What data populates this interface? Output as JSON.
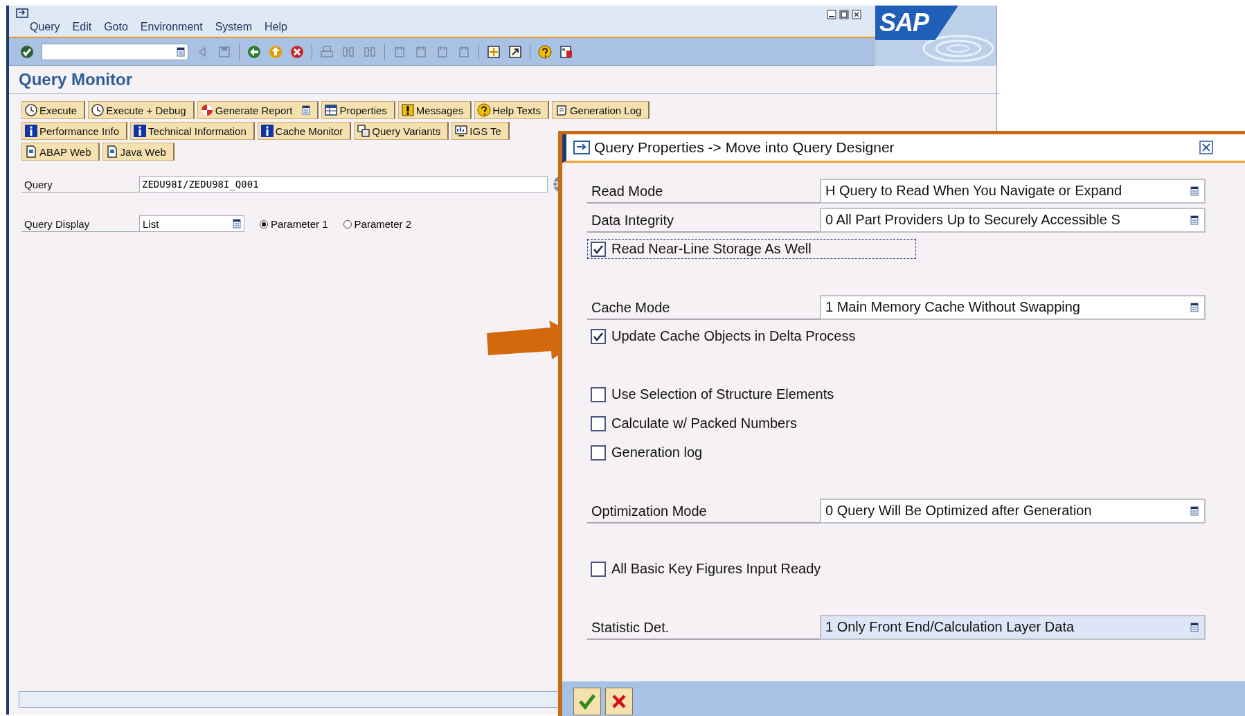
{
  "window": {
    "menu": [
      {
        "label": "Query"
      },
      {
        "label": "Edit"
      },
      {
        "label": "Goto"
      },
      {
        "label": "Environment"
      },
      {
        "label": "System"
      },
      {
        "label": "Help"
      }
    ],
    "logo": "SAP"
  },
  "title": "Query Monitor",
  "button_rows": [
    [
      {
        "label": "Execute",
        "has_menu": false
      },
      {
        "label": "Execute + Debug",
        "has_menu": false
      },
      {
        "label": "Generate Report",
        "has_menu": true
      },
      {
        "label": "Properties",
        "has_menu": false
      },
      {
        "label": "Messages",
        "has_menu": false
      },
      {
        "label": "Help Texts",
        "has_menu": false
      },
      {
        "label": "Generation Log",
        "has_menu": false
      }
    ],
    [
      {
        "label": "Performance Info",
        "has_menu": false
      },
      {
        "label": "Technical Information",
        "has_menu": false
      },
      {
        "label": "Cache Monitor",
        "has_menu": false
      },
      {
        "label": "Query Variants",
        "has_menu": false
      },
      {
        "label": "IGS Te",
        "has_menu": false
      }
    ],
    [
      {
        "label": "ABAP Web",
        "has_menu": false
      },
      {
        "label": "Java Web",
        "has_menu": false
      }
    ]
  ],
  "form": {
    "query": {
      "label": "Query",
      "value": "ZEDU98I/ZEDU98I_Q001"
    },
    "display": {
      "label": "Query Display",
      "value": "List"
    },
    "options": [
      {
        "label": "Parameter 1",
        "selected": true
      },
      {
        "label": "Parameter 2",
        "selected": false
      }
    ]
  },
  "dialog": {
    "title": "Query Properties -> Move into Query Designer",
    "groups": [
      [
        {
          "kind": "field",
          "label": "Read Mode",
          "value": "H Query to Read When You Navigate or Expand",
          "highlighted": false
        },
        {
          "kind": "field",
          "label": "Data Integrity",
          "value": "0 All Part Providers Up to Securely Accessible S",
          "highlighted": false
        },
        {
          "kind": "checkbox",
          "label": "Read Near-Line Storage As Well",
          "checked": true,
          "focused": true
        }
      ],
      [
        {
          "kind": "field",
          "label": "Cache Mode",
          "value": "1 Main Memory Cache Without Swapping",
          "highlighted": false
        },
        {
          "kind": "checkbox",
          "label": "Update Cache Objects in Delta Process",
          "checked": true,
          "focused": false
        }
      ],
      [
        {
          "kind": "checkbox",
          "label": "Use Selection of Structure Elements",
          "checked": false,
          "focused": false
        },
        {
          "kind": "checkbox",
          "label": "Calculate w/ Packed Numbers",
          "checked": false,
          "focused": false
        },
        {
          "kind": "checkbox",
          "label": "Generation log",
          "checked": false,
          "focused": false
        }
      ],
      [
        {
          "kind": "field",
          "label": "Optimization Mode",
          "value": "0 Query Will Be Optimized after Generation",
          "highlighted": false
        }
      ],
      [
        {
          "kind": "checkbox",
          "label": "All Basic Key Figures Input Ready",
          "checked": false,
          "focused": false
        }
      ],
      [
        {
          "kind": "field",
          "label": "Statistic Det.",
          "value": "1 Only Front End/Calculation Layer Data",
          "highlighted": true
        }
      ]
    ]
  }
}
